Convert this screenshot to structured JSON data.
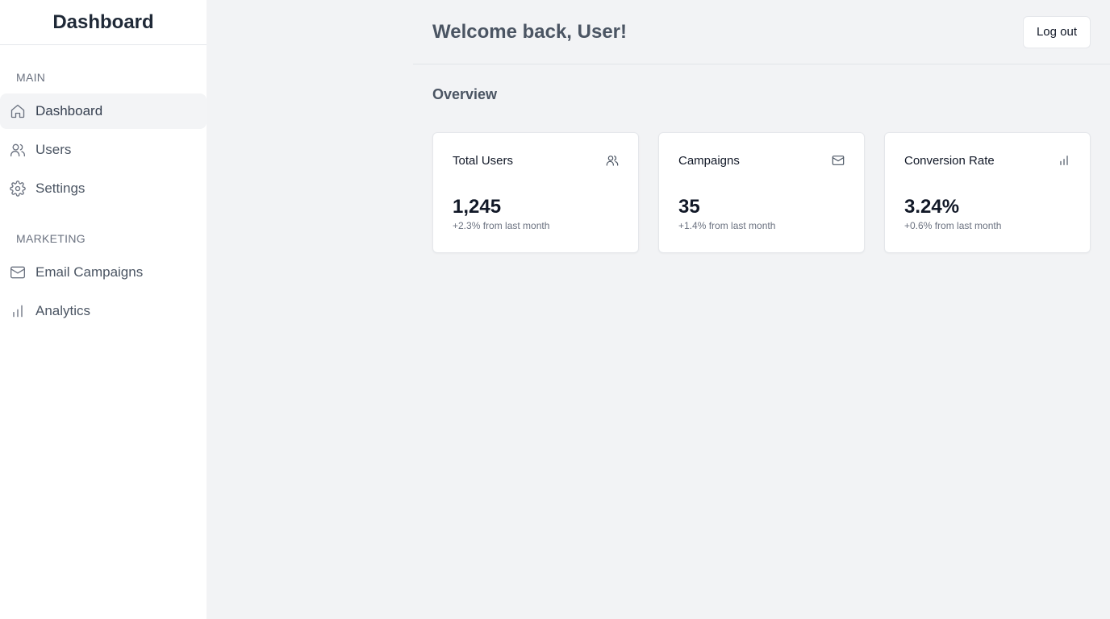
{
  "sidebar": {
    "brand": "Dashboard",
    "sections": [
      {
        "label": "MAIN",
        "items": [
          {
            "label": "Dashboard",
            "icon": "home-icon",
            "active": true
          },
          {
            "label": "Users",
            "icon": "users-icon",
            "active": false
          },
          {
            "label": "Settings",
            "icon": "gear-icon",
            "active": false
          }
        ]
      },
      {
        "label": "MARKETING",
        "items": [
          {
            "label": "Email Campaigns",
            "icon": "mail-icon",
            "active": false
          },
          {
            "label": "Analytics",
            "icon": "bar-chart-icon",
            "active": false
          }
        ]
      }
    ]
  },
  "header": {
    "welcome": "Welcome back, User!",
    "logout_label": "Log out"
  },
  "main": {
    "section_title": "Overview",
    "cards": [
      {
        "title": "Total Users",
        "icon": "users-icon",
        "value": "1,245",
        "sub": "+2.3% from last month"
      },
      {
        "title": "Campaigns",
        "icon": "mail-icon",
        "value": "35",
        "sub": "+1.4% from last month"
      },
      {
        "title": "Conversion Rate",
        "icon": "bar-chart-icon",
        "value": "3.24%",
        "sub": "+0.6% from last month"
      }
    ]
  },
  "colors": {
    "background": "#f2f3f5",
    "sidebar_bg": "#ffffff",
    "active_item_bg": "#f3f4f6",
    "text_muted": "#6b7280"
  }
}
